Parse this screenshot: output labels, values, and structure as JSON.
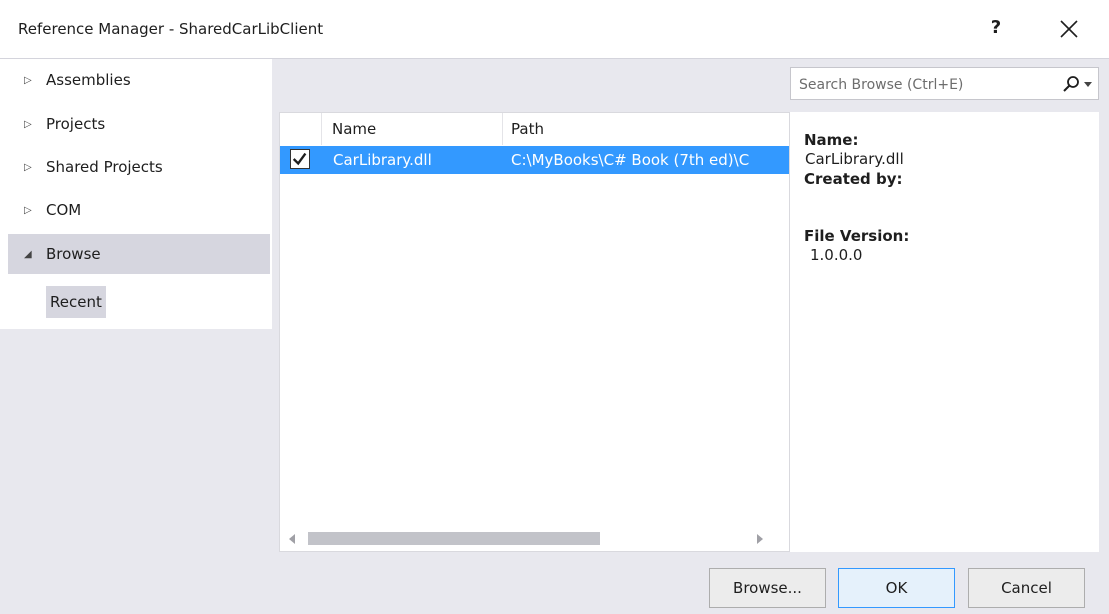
{
  "window": {
    "title": "Reference Manager - SharedCarLibClient",
    "help_label": "?"
  },
  "nav": {
    "items": [
      {
        "label": "Assemblies",
        "arrow": "▷",
        "selected": false
      },
      {
        "label": "Projects",
        "arrow": "▷",
        "selected": false
      },
      {
        "label": "Shared Projects",
        "arrow": "▷",
        "selected": false
      },
      {
        "label": "COM",
        "arrow": "▷",
        "selected": false
      },
      {
        "label": "Browse",
        "arrow": "◢",
        "selected": true
      }
    ],
    "subitem": "Recent"
  },
  "search": {
    "placeholder": "Search Browse (Ctrl+E)",
    "icon": "search-icon"
  },
  "list": {
    "columns": [
      "Name",
      "Path"
    ],
    "rows": [
      {
        "checked": true,
        "name": "CarLibrary.dll",
        "path": "C:\\MyBooks\\C# Book (7th ed)\\C"
      }
    ]
  },
  "details": {
    "name_label": "Name:",
    "name_value": "CarLibrary.dll",
    "created_label": "Created by:",
    "version_label": "File Version:",
    "version_value": "1.0.0.0"
  },
  "buttons": {
    "browse": "Browse...",
    "ok": "OK",
    "cancel": "Cancel"
  },
  "colors": {
    "selection": "#3399ff",
    "nav_selected": "#d6d6df",
    "dialog_bg": "#e8e8ee"
  }
}
